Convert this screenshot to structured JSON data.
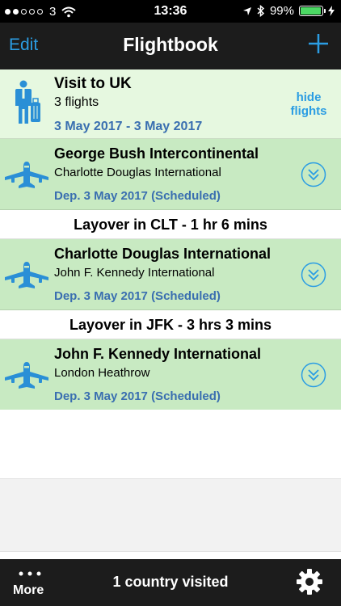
{
  "status": {
    "carrier": "3",
    "time": "13:36",
    "battery": "99%"
  },
  "nav": {
    "edit_label": "Edit",
    "title": "Flightbook",
    "add_icon": "plus-icon"
  },
  "trip": {
    "title": "Visit to UK",
    "count": "3 flights",
    "dates": "3 May 2017 - 3 May 2017",
    "hide_line1": "hide",
    "hide_line2": "flights"
  },
  "flights": [
    {
      "origin": "George Bush Intercontinental",
      "destination": "Charlotte Douglas International",
      "departure": "Dep. 3 May 2017 (Scheduled)"
    },
    {
      "origin": "Charlotte Douglas International",
      "destination": "John F. Kennedy International",
      "departure": "Dep. 3 May 2017 (Scheduled)"
    },
    {
      "origin": "John F. Kennedy International",
      "destination": "London Heathrow",
      "departure": "Dep. 3 May 2017 (Scheduled)"
    }
  ],
  "layovers": [
    "Layover in CLT -  1 hr 6 mins",
    "Layover in JFK -  3 hrs 3 mins"
  ],
  "bottom": {
    "more_label": "More",
    "summary": "1 country visited",
    "settings_icon": "gear-icon"
  },
  "colors": {
    "accent": "#2b9de3",
    "flight_bg": "#c8eac2",
    "trip_bg": "#e6f8e0",
    "date_text": "#3a6fb0"
  }
}
